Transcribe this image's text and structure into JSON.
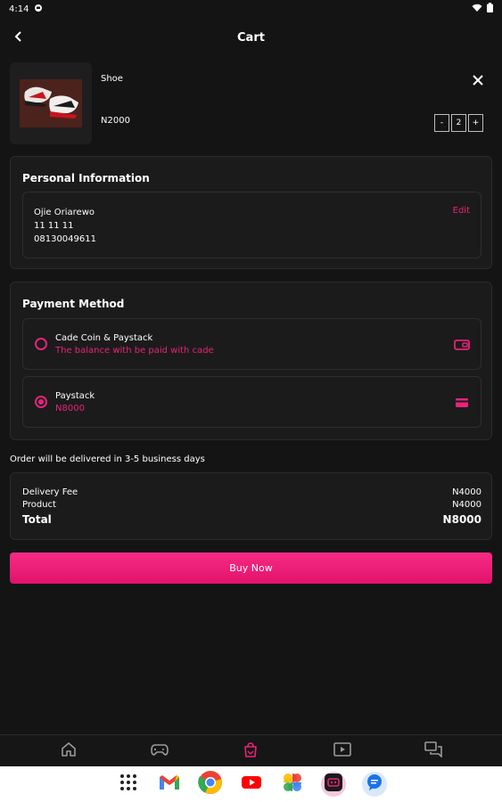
{
  "status_bar": {
    "time": "4:14",
    "battery_icon": "battery-icon",
    "wifi_icon": "wifi-icon"
  },
  "header": {
    "title": "Cart"
  },
  "cart": {
    "items": [
      {
        "name": "Shoe",
        "price": "N2000",
        "quantity": "2",
        "decrement_label": "-",
        "increment_label": "+"
      }
    ]
  },
  "personal_info": {
    "title": "Personal Information",
    "name": "Ojie Oriarewo",
    "address": "11 11 11",
    "phone": "08130049611",
    "edit_label": "Edit"
  },
  "payment": {
    "title": "Payment Method",
    "options": [
      {
        "title": "Cade Coin & Paystack",
        "subtitle": "The balance with be paid with cade",
        "selected": false,
        "icon": "wallet-icon"
      },
      {
        "title": "Paystack",
        "subtitle": "N8000",
        "selected": true,
        "icon": "card-icon"
      }
    ]
  },
  "delivery_note": "Order will be delivered in 3-5 business days",
  "summary": {
    "delivery_fee_label": "Delivery Fee",
    "delivery_fee_value": "N4000",
    "product_label": "Product",
    "product_value": "N4000",
    "total_label": "Total",
    "total_value": "N8000"
  },
  "buy_button": {
    "label": "Buy Now"
  },
  "bottom_nav": [
    "home-icon",
    "gamepad-icon",
    "shopping-bag-icon",
    "video-icon",
    "chat-icon"
  ],
  "dock": [
    "app-grid-icon",
    "gmail-icon",
    "chrome-icon",
    "youtube-icon",
    "photos-icon",
    "cade-app-icon",
    "messages-icon"
  ],
  "colors": {
    "accent": "#e8227a",
    "background": "#141414",
    "card": "#1b1b1b"
  }
}
